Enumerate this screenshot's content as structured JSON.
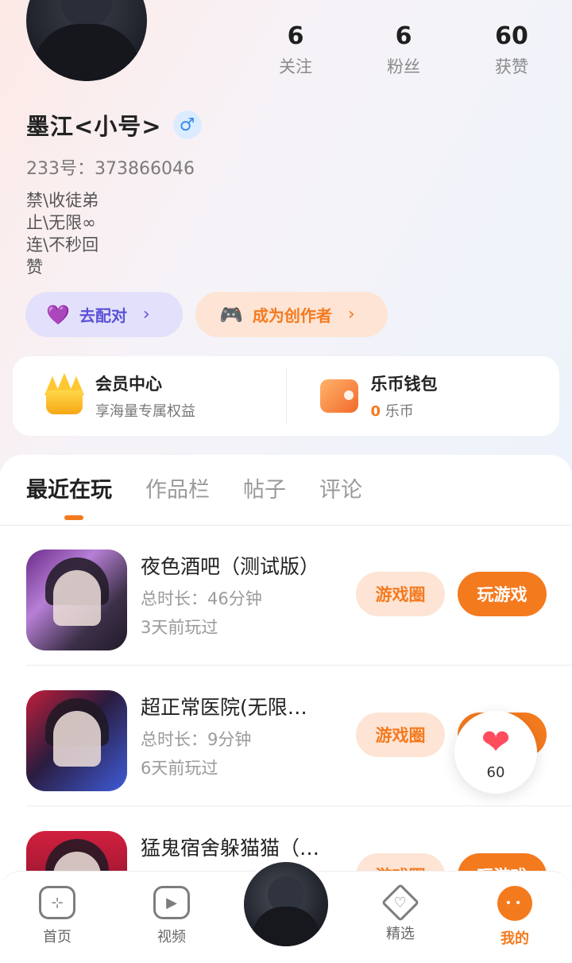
{
  "profile": {
    "nickname": "墨江<小号>",
    "gender_icon": "♂",
    "uid": "233号：373866046",
    "bio": [
      "禁\\收徒弟",
      "止\\无限∞",
      "连\\不秒回",
      "赞"
    ]
  },
  "stats": [
    {
      "num": "6",
      "label": "关注"
    },
    {
      "num": "6",
      "label": "粉丝"
    },
    {
      "num": "60",
      "label": "获赞"
    }
  ],
  "actions": {
    "pair_label": "去配对",
    "pair_icon": "heart-pair-icon",
    "creator_label": "成为创作者",
    "creator_icon": "gamepad-icon",
    "chevron": "›"
  },
  "card": {
    "vip_title": "会员中心",
    "vip_sub": "享海量专属权益",
    "wallet_title": "乐币钱包",
    "wallet_amount": "0",
    "wallet_unit": "乐币"
  },
  "tabs": [
    "最近在玩",
    "作品栏",
    "帖子",
    "评论"
  ],
  "games": [
    {
      "title": "夜色酒吧（测试版）",
      "duration": "总时长：46分钟",
      "last": "3天前玩过",
      "circle_label": "游戏圈",
      "play_label": "玩游戏"
    },
    {
      "title": "超正常医院(无限…",
      "duration": "总时长：9分钟",
      "last": "6天前玩过",
      "circle_label": "游戏圈",
      "play_label": "玩游戏"
    },
    {
      "title": "猛鬼宿舍躲猫猫（…",
      "duration": "",
      "last": "",
      "circle_label": "游戏圈",
      "play_label": "玩游戏"
    }
  ],
  "float_like": {
    "icon": "heart-icon",
    "count": "60"
  },
  "nav": [
    {
      "label": "首页",
      "icon": "gamepad-icon"
    },
    {
      "label": "视频",
      "icon": "play-icon"
    },
    {
      "label": "精选",
      "icon": "diamond-heart-icon"
    },
    {
      "label": "我的",
      "icon": "face-icon"
    }
  ],
  "colors": {
    "accent": "#f47a1e",
    "pair": "#5b52d6",
    "male_blue": "#3a8bf0"
  }
}
